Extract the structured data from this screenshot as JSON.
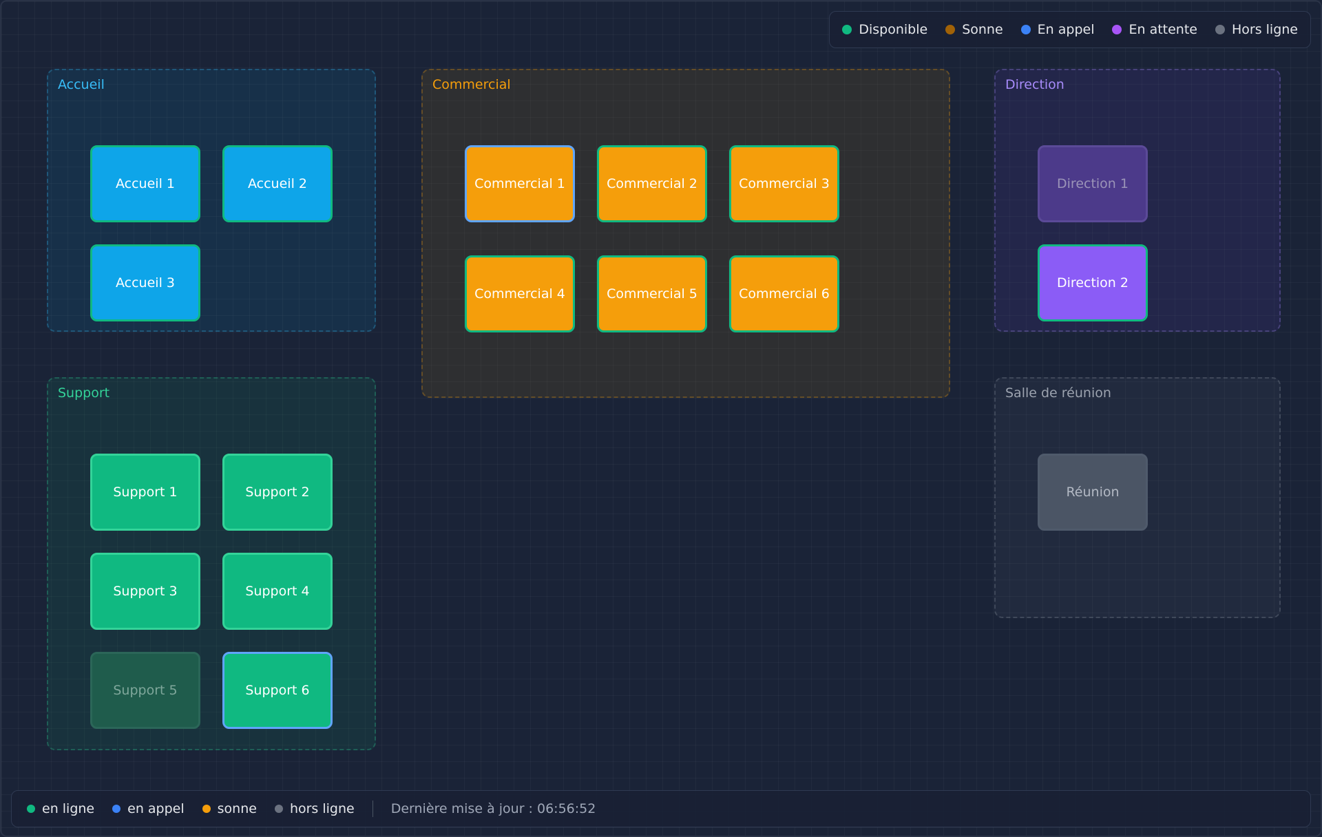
{
  "legend": {
    "items": [
      {
        "label": "Disponible",
        "color": "#10b981"
      },
      {
        "label": "Sonne",
        "color": "#a16207"
      },
      {
        "label": "En appel",
        "color": "#3b82f6"
      },
      {
        "label": "En attente",
        "color": "#a855f7"
      },
      {
        "label": "Hors ligne",
        "color": "#6b7280"
      }
    ]
  },
  "groups": {
    "accueil": {
      "title": "Accueil",
      "color": "#38bdf8"
    },
    "commercial": {
      "title": "Commercial",
      "color": "#f59e0b"
    },
    "direction": {
      "title": "Direction",
      "color": "#a78bfa"
    },
    "support": {
      "title": "Support",
      "color": "#34d399"
    },
    "reunion": {
      "title": "Salle de réunion",
      "color": "#9ca3af"
    }
  },
  "extensions": {
    "accueil_1": {
      "label": "Accueil 1",
      "status": "ringing"
    },
    "accueil_2": {
      "label": "Accueil 2",
      "status": "ringing"
    },
    "accueil_3": {
      "label": "Accueil 3",
      "status": "ringing"
    },
    "commercial_1": {
      "label": "Commercial 1",
      "status": "ringing"
    },
    "commercial_2": {
      "label": "Commercial 2",
      "status": "ringing"
    },
    "commercial_3": {
      "label": "Commercial 3",
      "status": "ringing"
    },
    "commercial_4": {
      "label": "Commercial 4",
      "status": "ringing"
    },
    "commercial_5": {
      "label": "Commercial 5",
      "status": "ringing"
    },
    "commercial_6": {
      "label": "Commercial 6",
      "status": "ringing"
    },
    "direction_1": {
      "label": "Direction 1",
      "status": "offline"
    },
    "direction_2": {
      "label": "Direction 2",
      "status": "on-hold"
    },
    "support_1": {
      "label": "Support 1",
      "status": "available"
    },
    "support_2": {
      "label": "Support 2",
      "status": "available"
    },
    "support_3": {
      "label": "Support 3",
      "status": "available"
    },
    "support_4": {
      "label": "Support 4",
      "status": "available"
    },
    "support_5": {
      "label": "Support 5",
      "status": "offline"
    },
    "support_6": {
      "label": "Support 6",
      "status": "available"
    },
    "reunion": {
      "label": "Réunion",
      "status": "offline"
    }
  },
  "footer": {
    "items": [
      {
        "label": "en ligne",
        "color": "#10b981"
      },
      {
        "label": "en appel",
        "color": "#3b82f6"
      },
      {
        "label": "sonne",
        "color": "#f59e0b"
      },
      {
        "label": "hors ligne",
        "color": "#6b7280"
      }
    ],
    "last_update": "Dernière mise à jour : 06:56:52"
  }
}
